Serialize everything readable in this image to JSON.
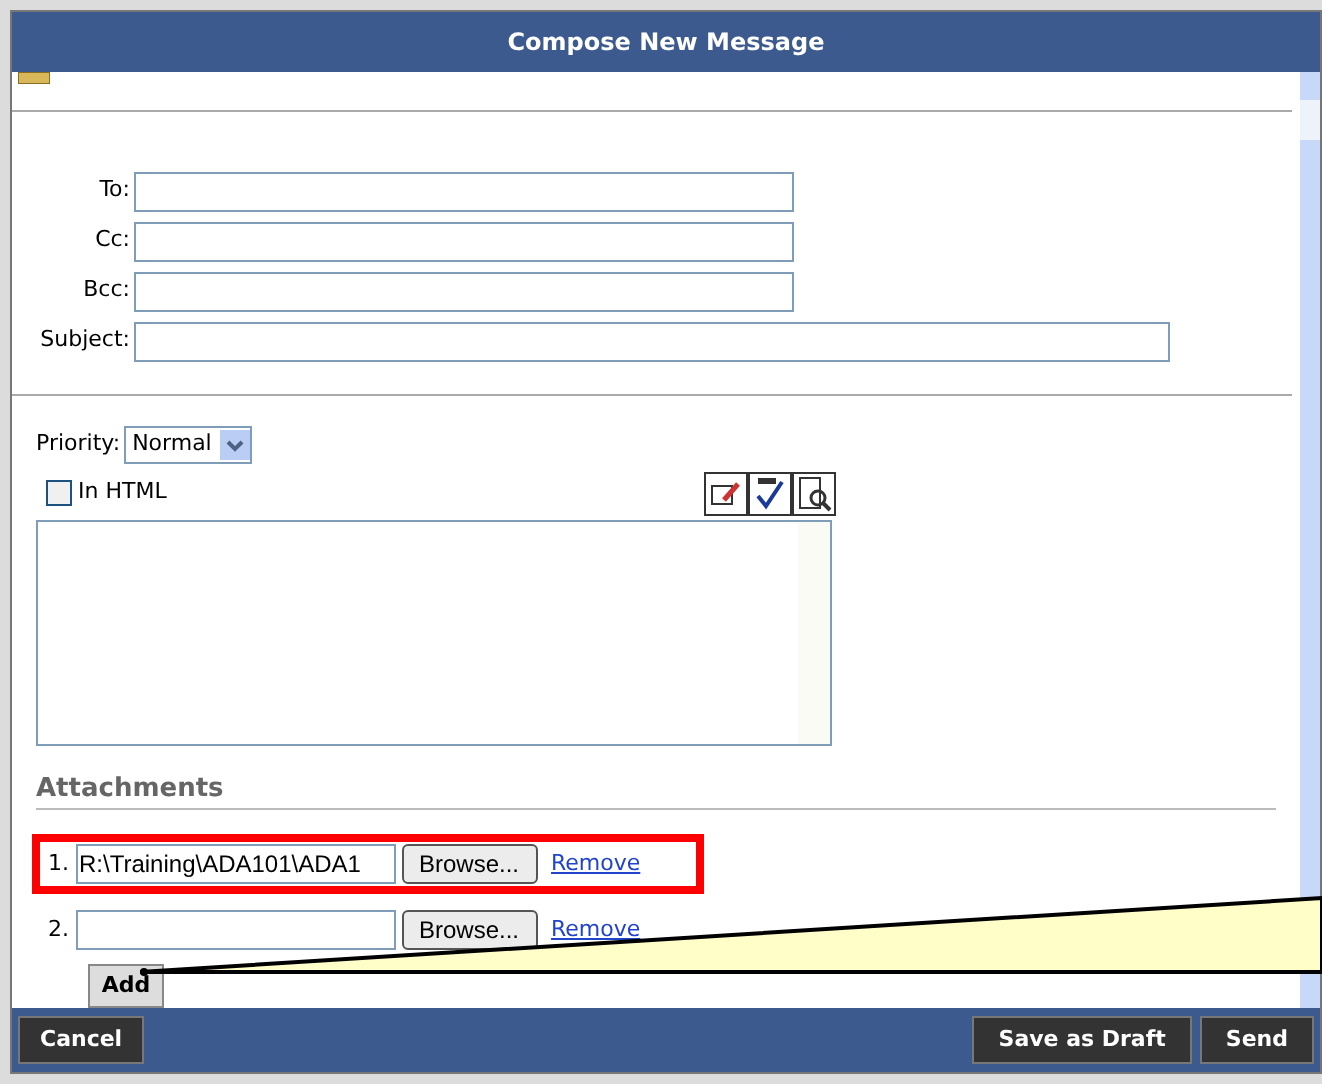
{
  "window": {
    "title": "Compose New Message"
  },
  "fields": [
    {
      "label": "To:",
      "kind": "short"
    },
    {
      "label": "Cc:",
      "kind": "short"
    },
    {
      "label": "Bcc:",
      "kind": "short"
    },
    {
      "label": "Subject:",
      "kind": "long"
    }
  ],
  "priority": {
    "label": "Priority:",
    "value": "Normal"
  },
  "in_html": {
    "label": "In HTML",
    "checked": false
  },
  "attachments": {
    "heading": "Attachments",
    "rows": [
      {
        "number": "1.",
        "value": "R:\\Training\\ADA101\\ADA1",
        "browse": "Browse...",
        "remove": "Remove",
        "highlighted": true
      },
      {
        "number": "2.",
        "value": "",
        "browse": "Browse...",
        "remove": "Remove",
        "highlighted": false
      }
    ],
    "add": "Add"
  },
  "footer": {
    "left": [
      "Cancel"
    ],
    "right": [
      "Save as Draft",
      "Send"
    ]
  }
}
